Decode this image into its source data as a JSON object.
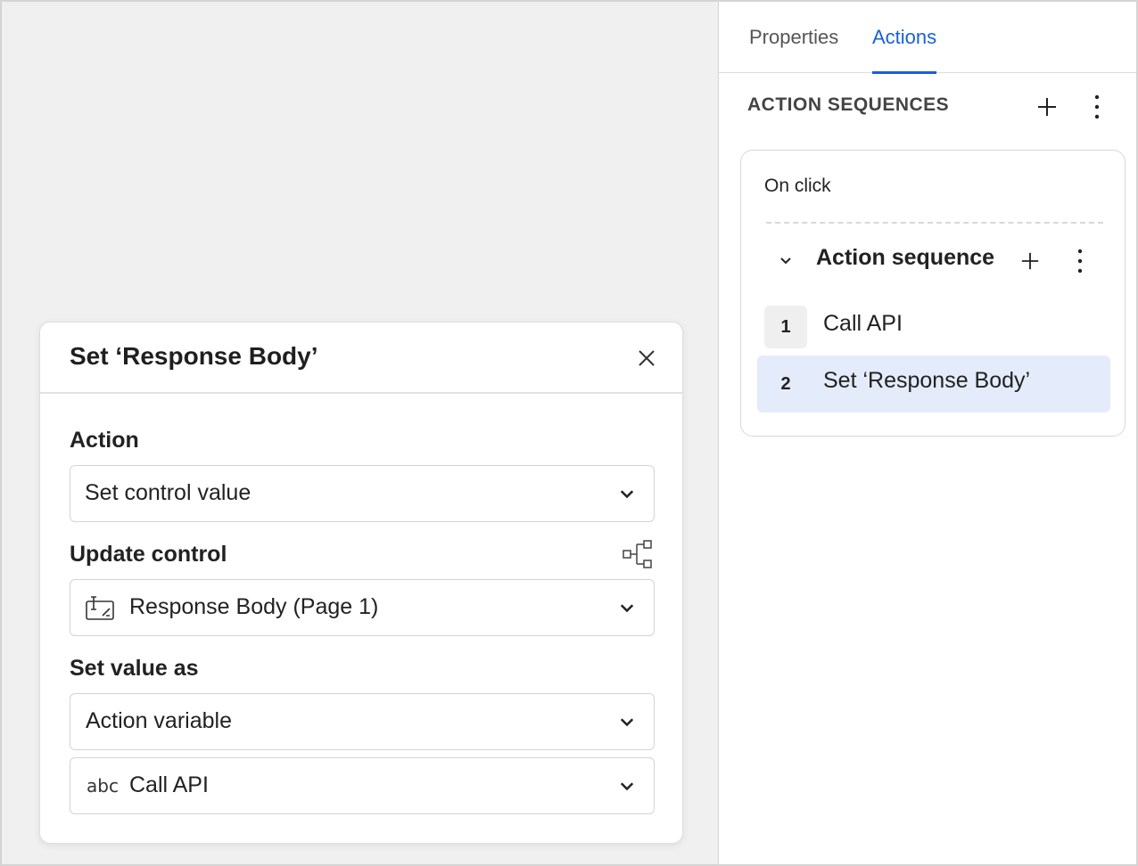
{
  "tabs": [
    {
      "label": "Properties",
      "active": false
    },
    {
      "label": "Actions",
      "active": true
    }
  ],
  "actions_panel": {
    "section_title": "ACTION SEQUENCES",
    "trigger": "On click",
    "sequence_title": "Action sequence",
    "steps": [
      {
        "number": "1",
        "label": "Call API",
        "selected": false
      },
      {
        "number": "2",
        "label": "Set ‘Response Body’",
        "selected": true
      }
    ]
  },
  "modal": {
    "title": "Set ‘Response Body’",
    "action_label": "Action",
    "action_value": "Set control value",
    "update_control_label": "Update control",
    "update_control_value": "Response Body (Page 1)",
    "set_value_label": "Set value as",
    "set_value_value": "Action variable",
    "variable_value": "Call API",
    "variable_type": "abc"
  },
  "colors": {
    "accent": "#1a5fd9",
    "selected_bg": "#e4ebfb",
    "canvas_bg": "#f0f0f0"
  },
  "icons": [
    "plus-icon",
    "more-vertical-icon",
    "chevron-down-icon",
    "close-icon",
    "hierarchy-icon",
    "text-input-icon",
    "abc-type-icon"
  ]
}
